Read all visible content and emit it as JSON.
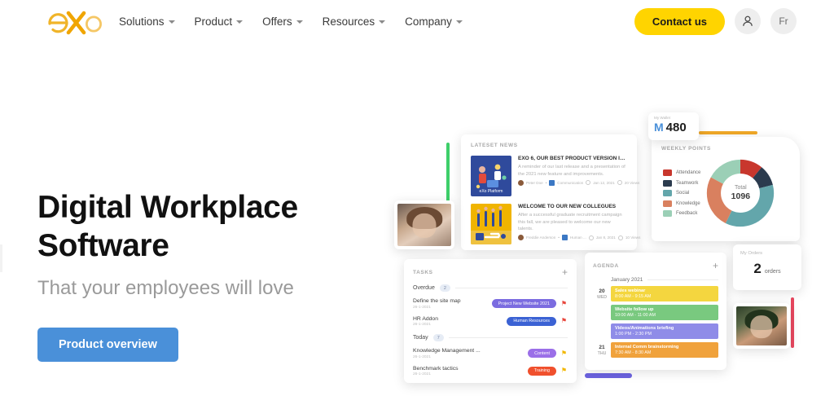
{
  "header": {
    "logo_alt": "eXo",
    "nav": [
      {
        "label": "Solutions"
      },
      {
        "label": "Product"
      },
      {
        "label": "Offers"
      },
      {
        "label": "Resources"
      },
      {
        "label": "Company"
      }
    ],
    "contact_label": "Contact us",
    "account_icon": "person-icon",
    "language_label": "Fr"
  },
  "hero": {
    "title_line1": "Digital Workplace",
    "title_line2": "Software",
    "subtitle": "That your employees will love",
    "cta_label": "Product overview"
  },
  "illustration": {
    "news": {
      "heading": "LATESET NEWS",
      "items": [
        {
          "title": "EXO 6, OUR BEST PRODUCT VERSION IN 10 ...",
          "description": "A reminder of our last release and a presentation of the 2021 new feature and improvements.",
          "author": "Peter Doe",
          "space": "Communication",
          "date": "Jan 12, 2021",
          "views": "20 Views"
        },
        {
          "title": "WELCOME TO OUR NEW COLLEGUES",
          "description": "After a successful graduate recruitment campaign this fall, we are pleased to welcome our new talents.",
          "author": "Freddie Anderson",
          "space": "Human ...",
          "date": "Jan 8, 2021",
          "views": "10 Views"
        }
      ]
    },
    "wallet": {
      "label": "My Wallet",
      "symbol": "M",
      "amount": "480"
    },
    "points": {
      "heading": "WEEKLY POINTS",
      "total_label": "Total",
      "total_value": "1096",
      "legend": [
        {
          "label": "Attendance",
          "color": "#c8372d",
          "value": 120
        },
        {
          "label": "Teamwork",
          "color": "#2b3b4e",
          "value": 110
        },
        {
          "label": "Social",
          "color": "#63a6ab",
          "value": 396
        },
        {
          "label": "Knowledge",
          "color": "#d9805f",
          "value": 280
        },
        {
          "label": "Feedback",
          "color": "#9bcfb6",
          "value": 190
        }
      ]
    },
    "tasks": {
      "heading": "TASKS",
      "add_icon": "plus-icon",
      "groups": [
        {
          "label": "Overdue",
          "count": "2",
          "items": [
            {
              "name": "Define the site map",
              "date": "26-1-2021",
              "tag": "Project New Website 2021",
              "tag_color": "#7b6ce0",
              "flag_color": "#e8463c"
            },
            {
              "name": "HR Addon",
              "date": "26-1-2021",
              "tag": "Human Resources",
              "tag_color": "#3b62d4",
              "flag_color": "#e8463c"
            }
          ]
        },
        {
          "label": "Today",
          "count": "7",
          "items": [
            {
              "name": "Knowledge Management ...",
              "date": "26-1-2021",
              "tag": "Content",
              "tag_color": "#9b6fe8",
              "flag_color": "#f2b700"
            },
            {
              "name": "Benchmark tactics",
              "date": "26-1-2021",
              "tag": "Training",
              "tag_color": "#f0502d",
              "flag_color": "#f2b700"
            }
          ]
        }
      ]
    },
    "agenda": {
      "heading": "AGENDA",
      "add_icon": "plus-icon",
      "month": "January 2021",
      "days": [
        {
          "day_number": "20",
          "day_name": "WED",
          "events": [
            {
              "title": "Sales webinar",
              "time": "8:00 AM - 9:15 AM",
              "color": "#f4d63f"
            },
            {
              "title": "Website follow up",
              "time": "10:00 AM - 11:00 AM",
              "color": "#79c97f"
            },
            {
              "title": "Videos/Animations briefing",
              "time": "1:00 PM - 2:30 PM",
              "color": "#8f8ce8"
            }
          ]
        },
        {
          "day_number": "21",
          "day_name": "THU",
          "events": [
            {
              "title": "Internal Comm brainstorming",
              "time": "7:30 AM - 8:30 AM",
              "color": "#f0a23c"
            }
          ]
        }
      ]
    },
    "orders": {
      "label": "My Orders",
      "count": "2",
      "unit": "orders"
    },
    "photo_left_alt": "profile-photo-woman",
    "photo_right_alt": "profile-photo-woman-2"
  },
  "colors": {
    "brand_yellow": "#ffd400",
    "cta_blue": "#4a90d9",
    "accent_green": "#3ecf6a",
    "accent_orange": "#f0a828",
    "accent_purple": "#6c63e0",
    "accent_red": "#e8475f"
  }
}
